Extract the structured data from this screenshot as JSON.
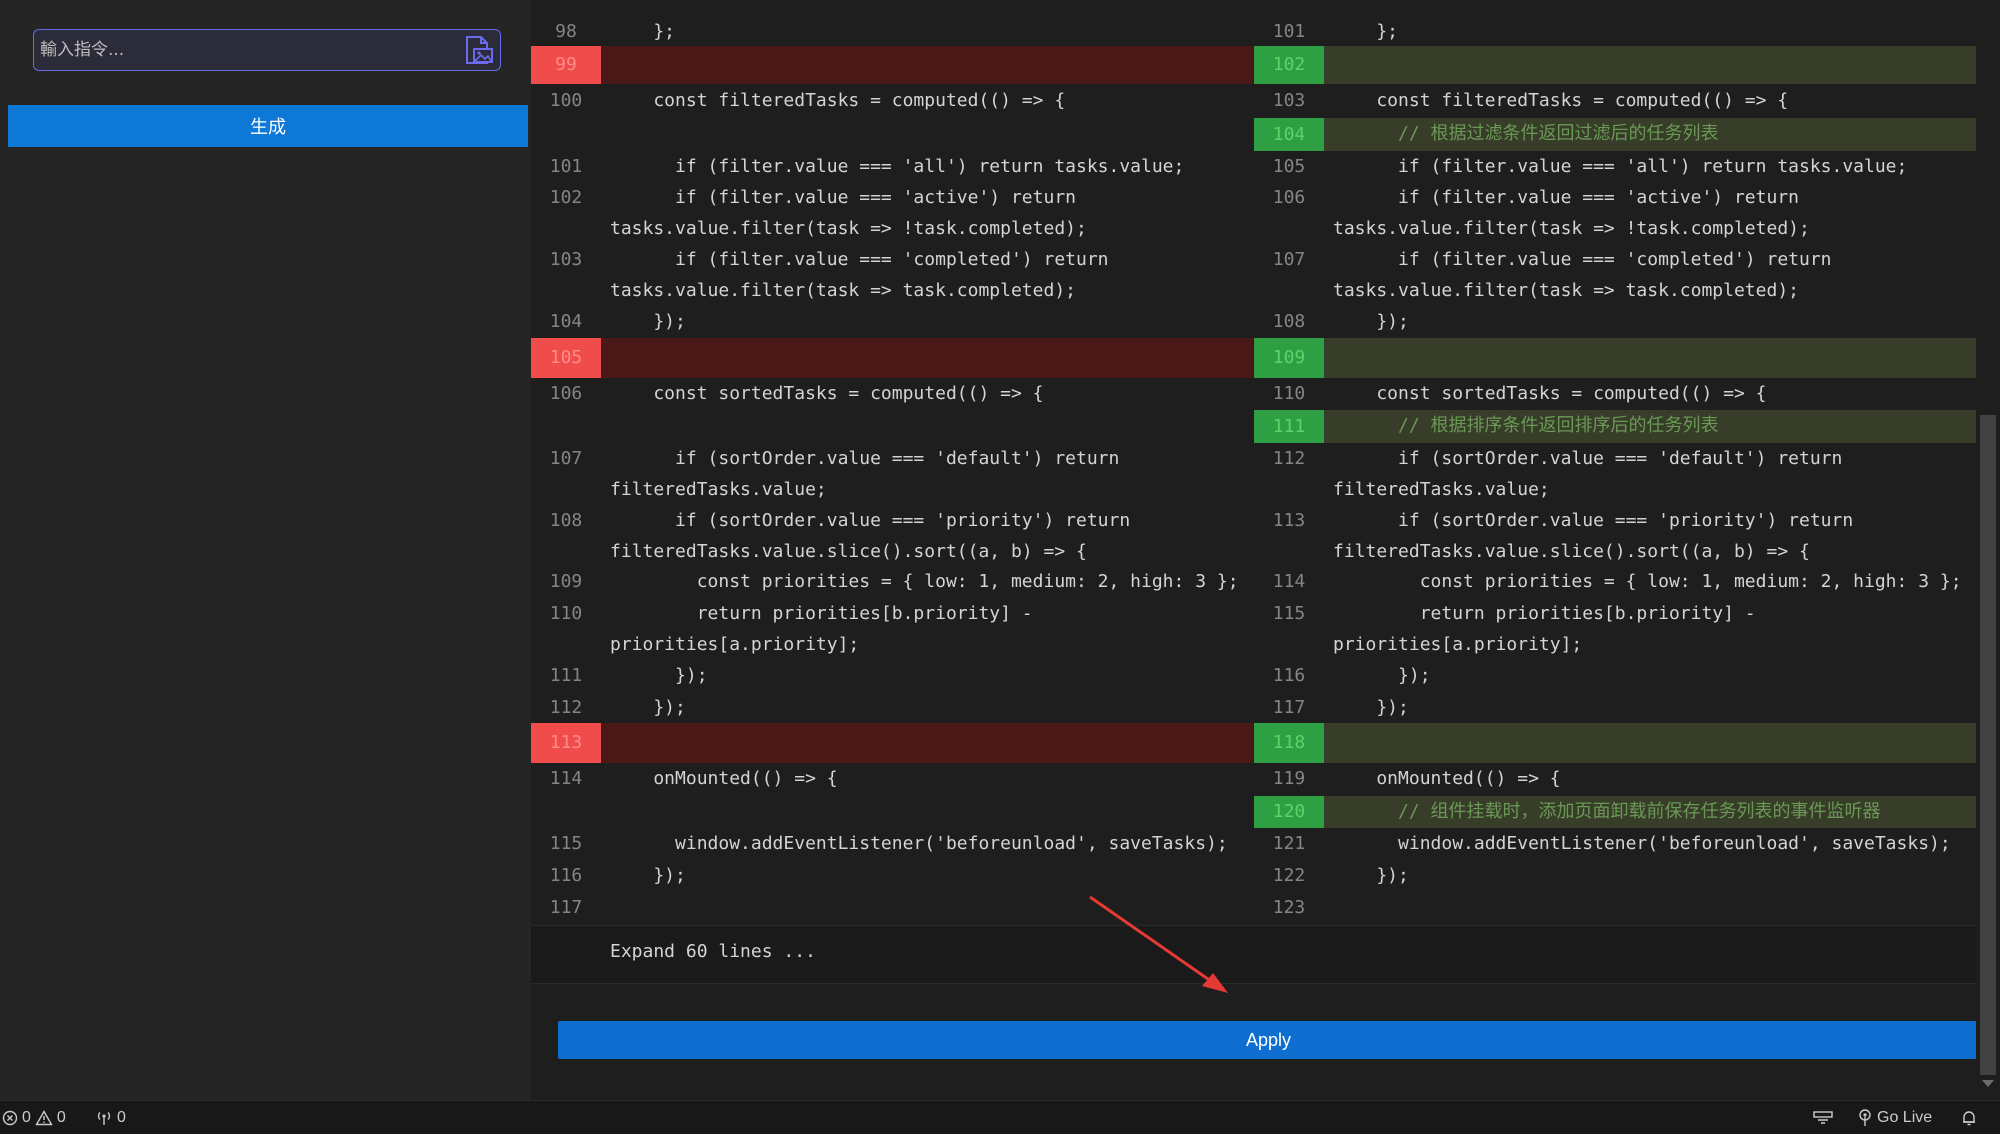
{
  "sidebar": {
    "input_placeholder": "輸入指令...",
    "generate_label": "生成",
    "image_icon": "image-file-icon"
  },
  "diff": {
    "left": [
      {
        "ln": "98",
        "code": "    };",
        "type": "normal"
      },
      {
        "ln": "99",
        "code": "",
        "type": "del"
      },
      {
        "ln": "100",
        "code": "    const filteredTasks = computed(() => {",
        "type": "normal"
      },
      {
        "ln": "101",
        "code": "      if (filter.value === 'all') return tasks.value;",
        "type": "normal"
      },
      {
        "ln": "102",
        "code": "      if (filter.value === 'active') return\ntasks.value.filter(task => !task.completed);",
        "type": "normal"
      },
      {
        "ln": "103",
        "code": "      if (filter.value === 'completed') return\ntasks.value.filter(task => task.completed);",
        "type": "normal"
      },
      {
        "ln": "104",
        "code": "    });",
        "type": "normal"
      },
      {
        "ln": "105",
        "code": "",
        "type": "del"
      },
      {
        "ln": "106",
        "code": "    const sortedTasks = computed(() => {",
        "type": "normal"
      },
      {
        "ln": "107",
        "code": "      if (sortOrder.value === 'default') return\nfilteredTasks.value;",
        "type": "normal"
      },
      {
        "ln": "108",
        "code": "      if (sortOrder.value === 'priority') return\nfilteredTasks.value.slice().sort((a, b) => {",
        "type": "normal"
      },
      {
        "ln": "109",
        "code": "        const priorities = { low: 1, medium: 2, high: 3 };",
        "type": "normal"
      },
      {
        "ln": "110",
        "code": "        return priorities[b.priority] -\npriorities[a.priority];",
        "type": "normal"
      },
      {
        "ln": "111",
        "code": "      });",
        "type": "normal"
      },
      {
        "ln": "112",
        "code": "    });",
        "type": "normal"
      },
      {
        "ln": "113",
        "code": "",
        "type": "del"
      },
      {
        "ln": "114",
        "code": "    onMounted(() => {",
        "type": "normal"
      },
      {
        "ln": "115",
        "code": "      window.addEventListener('beforeunload', saveTasks);",
        "type": "normal"
      },
      {
        "ln": "116",
        "code": "    });",
        "type": "normal"
      },
      {
        "ln": "117",
        "code": "",
        "type": "normal"
      }
    ],
    "right": [
      {
        "ln": "101",
        "code": "    };",
        "type": "normal"
      },
      {
        "ln": "102",
        "code": "",
        "type": "add"
      },
      {
        "ln": "103",
        "code": "    const filteredTasks = computed(() => {",
        "type": "normal"
      },
      {
        "ln": "104",
        "code": "      // 根据过滤条件返回过滤后的任务列表",
        "type": "add"
      },
      {
        "ln": "105",
        "code": "      if (filter.value === 'all') return tasks.value;",
        "type": "normal"
      },
      {
        "ln": "106",
        "code": "      if (filter.value === 'active') return\ntasks.value.filter(task => !task.completed);",
        "type": "normal"
      },
      {
        "ln": "107",
        "code": "      if (filter.value === 'completed') return\ntasks.value.filter(task => task.completed);",
        "type": "normal"
      },
      {
        "ln": "108",
        "code": "    });",
        "type": "normal"
      },
      {
        "ln": "109",
        "code": "",
        "type": "add"
      },
      {
        "ln": "110",
        "code": "    const sortedTasks = computed(() => {",
        "type": "normal"
      },
      {
        "ln": "111",
        "code": "      // 根据排序条件返回排序后的任务列表",
        "type": "add"
      },
      {
        "ln": "112",
        "code": "      if (sortOrder.value === 'default') return\nfilteredTasks.value;",
        "type": "normal"
      },
      {
        "ln": "113",
        "code": "      if (sortOrder.value === 'priority') return\nfilteredTasks.value.slice().sort((a, b) => {",
        "type": "normal"
      },
      {
        "ln": "114",
        "code": "        const priorities = { low: 1, medium: 2, high: 3 };",
        "type": "normal"
      },
      {
        "ln": "115",
        "code": "        return priorities[b.priority] -\npriorities[a.priority];",
        "type": "normal"
      },
      {
        "ln": "116",
        "code": "      });",
        "type": "normal"
      },
      {
        "ln": "117",
        "code": "    });",
        "type": "normal"
      },
      {
        "ln": "118",
        "code": "",
        "type": "add"
      },
      {
        "ln": "119",
        "code": "    onMounted(() => {",
        "type": "normal"
      },
      {
        "ln": "120",
        "code": "      // 组件挂载时，添加页面卸载前保存任务列表的事件监听器",
        "type": "add"
      },
      {
        "ln": "121",
        "code": "      window.addEventListener('beforeunload', saveTasks);",
        "type": "normal"
      },
      {
        "ln": "122",
        "code": "    });",
        "type": "normal"
      },
      {
        "ln": "123",
        "code": "",
        "type": "normal"
      }
    ],
    "expand_label": "Expand 60 lines ...",
    "apply_label": "Apply"
  },
  "statusbar": {
    "errors": "0",
    "warnings": "0",
    "ports": "0",
    "go_live": "Go Live"
  },
  "colors": {
    "deleted_row": "#4b1818",
    "deleted_gutter": "#f14c4c",
    "added_row": "#373d29",
    "added_gutter": "#2ea043",
    "button_blue": "#0e78d6",
    "annotation_arrow": "#e53935"
  }
}
